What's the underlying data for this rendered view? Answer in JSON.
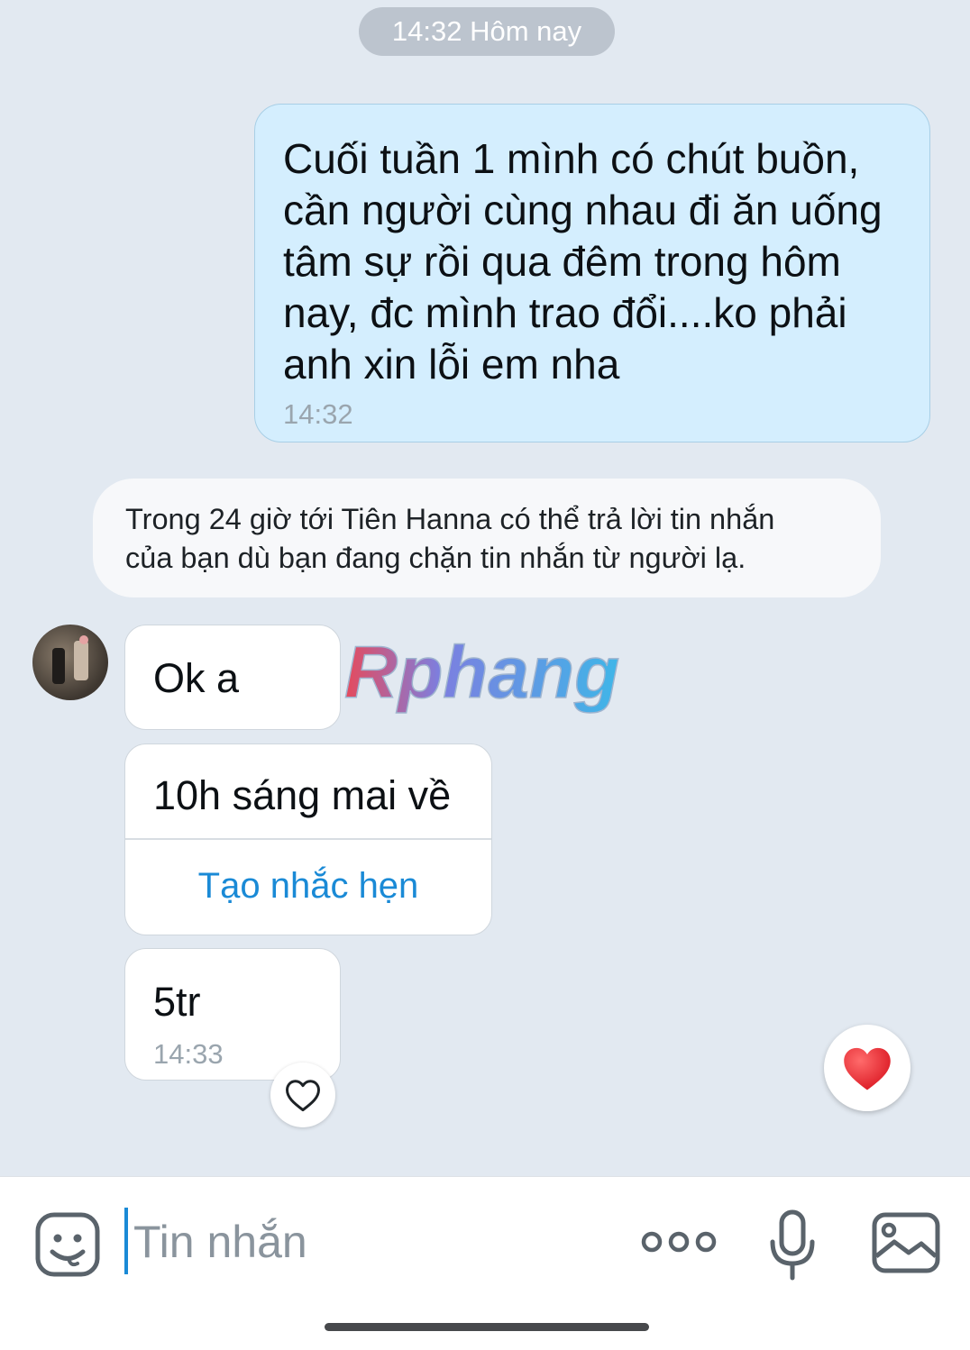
{
  "date_separator": "14:32 Hôm nay",
  "outgoing_message": {
    "text": "Cuối tuần 1 mình có chút buồn,\ncần người cùng nhau đi ăn uống\ntâm sự rồi qua đêm trong hôm\nnay, đc mình trao đổi....ko phải\nanh xin lỗi em nha",
    "time": "14:32"
  },
  "system_note": "Trong 24 giờ tới Tiên Hanna có thể trả lời tin nhắn\ncủa bạn dù bạn đang chặn tin nhắn từ người lạ.",
  "incoming_messages": [
    {
      "text": "Ok a"
    },
    {
      "text": "10h sáng mai về",
      "action": "Tạo nhắc hẹn"
    },
    {
      "text": "5tr",
      "time": "14:33"
    }
  ],
  "watermark": "Rphang",
  "composer": {
    "placeholder": "Tin nhắn"
  },
  "icons": {
    "emoji": "emoji-icon",
    "more": "more-icon",
    "mic": "microphone-icon",
    "image": "image-icon",
    "heart_outline": "heart-outline-icon",
    "heart_filled": "heart-filled-icon"
  },
  "colors": {
    "background": "#e2e9f1",
    "outgoing_bubble": "#d4eefe",
    "link_blue": "#1a8ad6",
    "heart_red": "#e8232d"
  }
}
